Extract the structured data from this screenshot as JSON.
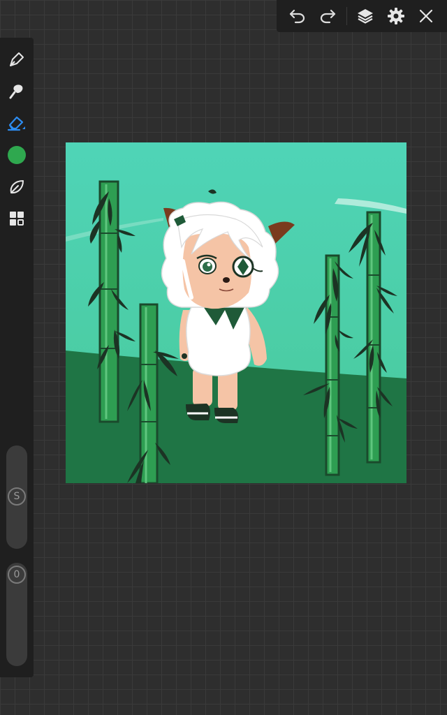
{
  "toolbar": {
    "icons": [
      "undo-icon",
      "redo-icon",
      "layers-icon",
      "gear-icon",
      "close-icon"
    ]
  },
  "sidebar": {
    "tools": [
      "pen-icon",
      "smudge-icon",
      "eraser-icon",
      "color-swatch",
      "leaf-brush-icon",
      "gallery-icon"
    ],
    "active_tool": "eraser",
    "current_color": "#2fa84f",
    "accent_color": "#2d8cf0",
    "size_slider": {
      "label": "S"
    },
    "opacity_slider": {
      "label": "0"
    }
  },
  "colors": {
    "sky_top": "#4fd4b7",
    "sky_bottom": "#49c99a",
    "hill": "#1f7545",
    "bamboo": "#2e9e52",
    "bamboo_outline": "#1a4a2c",
    "leaf": "#1c3324"
  }
}
